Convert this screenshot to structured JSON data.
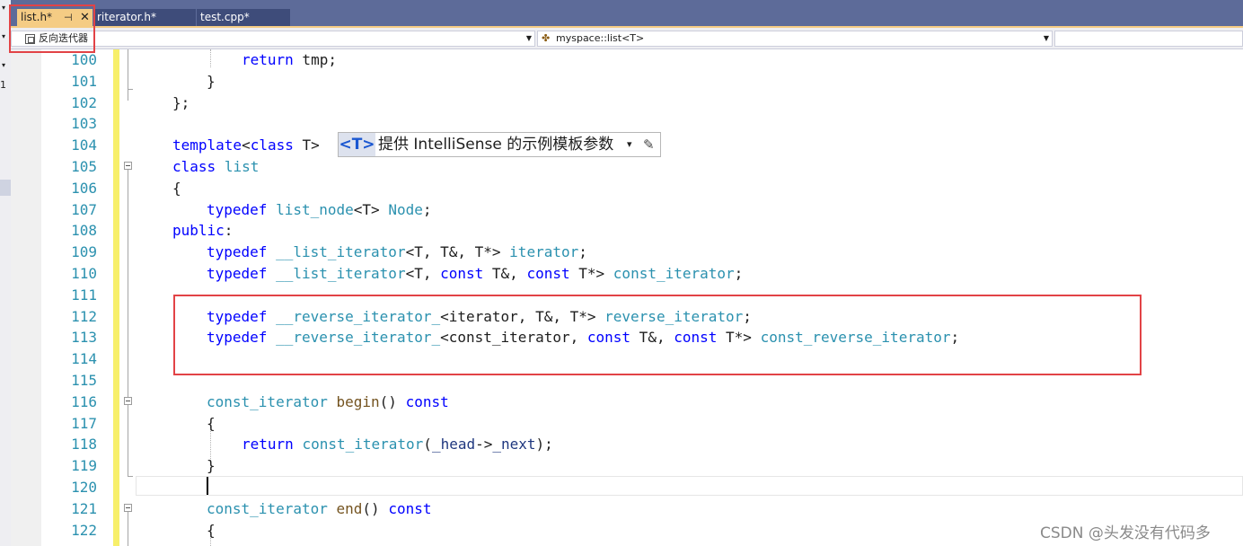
{
  "tabs": {
    "active": {
      "label": "list.h*",
      "pin": "⊣",
      "close": "✕"
    },
    "items": [
      {
        "label": "riterator.h*"
      },
      {
        "label": "test.cpp*"
      }
    ]
  },
  "navbar": {
    "scope_label": "反向迭代器",
    "class_label": "myspace::list<T>",
    "member_label": ""
  },
  "left_strip": {
    "digit": "1"
  },
  "template_bar": {
    "button_label": "<T>",
    "text": "提供 IntelliSense 的示例模板参数",
    "dropdown": "▾",
    "edit": "✎"
  },
  "editor": {
    "line_numbers": [
      "100",
      "101",
      "102",
      "103",
      "104",
      "105",
      "106",
      "107",
      "108",
      "109",
      "110",
      "111",
      "112",
      "113",
      "114",
      "115",
      "116",
      "117",
      "118",
      "119",
      "120",
      "121",
      "122"
    ],
    "code": {
      "l100_kw": "return",
      "l100_rest": " tmp;",
      "l101": "}",
      "l102": "};",
      "l104_kw": "template",
      "l104_a": "<",
      "l104_kw2": "class",
      "l104_b": " T>",
      "l105_kw": "class",
      "l105_ty": "list",
      "l106": "{",
      "l107_kw": "typedef",
      "l107_ty": "list_node",
      "l107_a": "<T> ",
      "l107_ty2": "Node",
      "l107_b": ";",
      "l108_kw": "public",
      "l108_b": ":",
      "l109_kw": "typedef",
      "l109_ty": "__list_iterator",
      "l109_a": "<T, T&, T*> ",
      "l109_ty2": "iterator",
      "l109_b": ";",
      "l110_kw": "typedef",
      "l110_ty": "__list_iterator",
      "l110_a": "<T, ",
      "l110_kw2": "const",
      "l110_b": " T&, ",
      "l110_kw3": "const",
      "l110_c": " T*> ",
      "l110_ty2": "const_iterator",
      "l110_d": ";",
      "l112_kw": "typedef",
      "l112_ty": "__reverse_iterator_",
      "l112_a": "<iterator, T&, T*> ",
      "l112_ty2": "reverse_iterator",
      "l112_b": ";",
      "l113_kw": "typedef",
      "l113_ty": "__reverse_iterator_",
      "l113_a": "<const_iterator, ",
      "l113_kw2": "const",
      "l113_b": " T&, ",
      "l113_kw3": "const",
      "l113_c": " T*> ",
      "l113_ty2": "const_reverse_iterator",
      "l113_d": ";",
      "l116_ty": "const_iterator",
      "l116_fn": "begin",
      "l116_a": "() ",
      "l116_kw": "const",
      "l117": "{",
      "l118_kw": "return",
      "l118_ty": "const_iterator",
      "l118_a": "(",
      "l118_mp": "_head",
      "l118_b": "->",
      "l118_mp2": "_next",
      "l118_c": ");",
      "l119": "}",
      "l121_ty": "const_iterator",
      "l121_fn": "end",
      "l121_a": "() ",
      "l121_kw": "const",
      "l122": "{"
    }
  },
  "watermark": "CSDN @头发没有代码多",
  "colors": {
    "keyword": "#0000ff",
    "type": "#2b91af",
    "function": "#74531f",
    "member": "#1f377f",
    "highlight_box": "#e24346",
    "tab_active": "#f5cc84",
    "tab_bar": "#5d6b99",
    "change_bar": "#f7ef6a"
  },
  "icons": [
    "pin-icon",
    "close-icon",
    "scope-icon",
    "class-icon",
    "dropdown-arrow-icon",
    "pencil-icon",
    "fold-toggle-icon"
  ]
}
